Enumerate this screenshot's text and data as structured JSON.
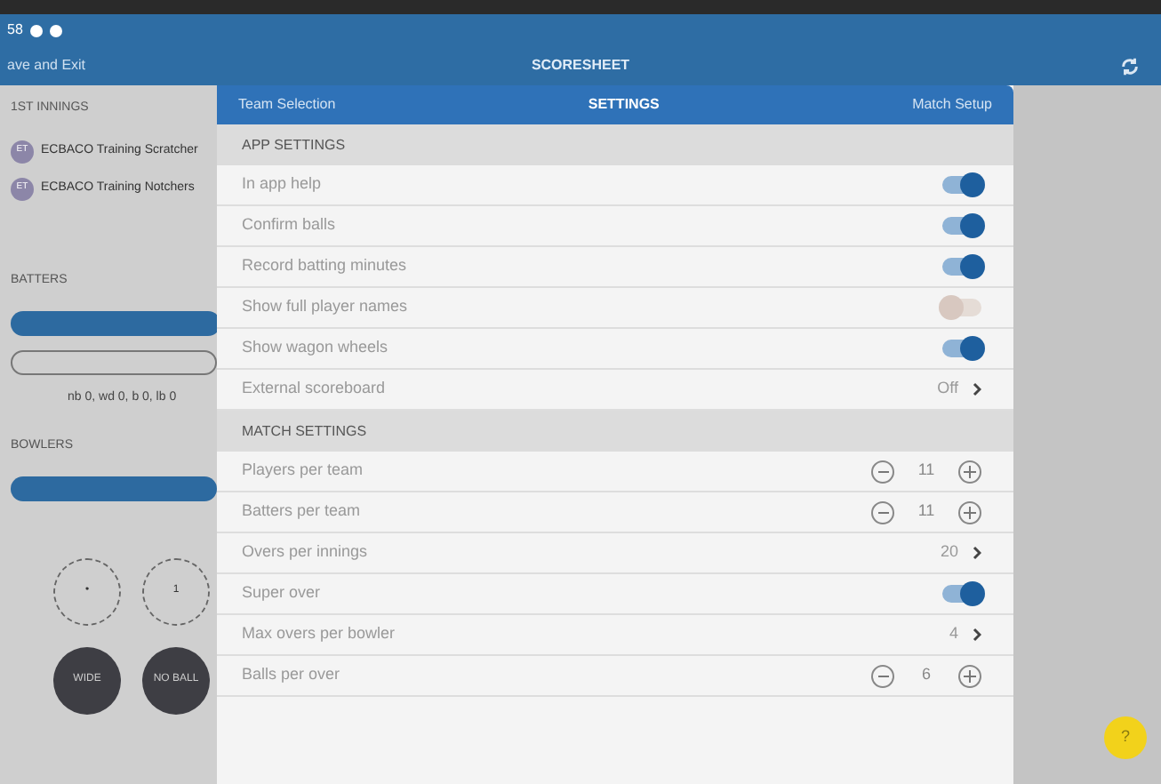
{
  "status_bar": {
    "time": "58"
  },
  "nav_bar": {
    "back": "ave and Exit",
    "title": "SCORESHEET"
  },
  "scoresheet": {
    "innings_title": "1ST INNINGS",
    "teams": [
      {
        "name": "ECBACO Training Scratcher",
        "initials": "ET"
      },
      {
        "name": "ECBACO Training Notchers",
        "initials": "ET"
      }
    ],
    "batters_title": "BATTERS",
    "extras": "nb 0, wd 0, b 0, lb 0",
    "bowlers_title": "BOWLERS",
    "ball_buttons": [
      {
        "label": "•",
        "kind": "outline"
      },
      {
        "label": "1",
        "kind": "outline"
      },
      {
        "label": "WIDE",
        "kind": "filled"
      },
      {
        "label": "NO BALL",
        "kind": "filled"
      }
    ]
  },
  "settings": {
    "tabs": [
      {
        "label": "Team Selection",
        "selected": false
      },
      {
        "label": "SETTINGS",
        "selected": true
      },
      {
        "label": "Match Setup",
        "selected": false
      }
    ],
    "sections": [
      {
        "title": "APP SETTINGS",
        "rows": [
          {
            "label": "In app help",
            "kind": "toggle",
            "on": true
          },
          {
            "label": "Confirm balls",
            "kind": "toggle",
            "on": true
          },
          {
            "label": "Record batting minutes",
            "kind": "toggle",
            "on": true
          },
          {
            "label": "Show full player names",
            "kind": "toggle",
            "on": false
          },
          {
            "label": "Show wagon wheels",
            "kind": "toggle",
            "on": true
          },
          {
            "label": "External scoreboard",
            "kind": "link",
            "value": "Off"
          }
        ]
      },
      {
        "title": "MATCH SETTINGS",
        "rows": [
          {
            "label": "Players per team",
            "kind": "stepper",
            "value": "11"
          },
          {
            "label": "Batters per team",
            "kind": "stepper",
            "value": "11"
          },
          {
            "label": "Overs per innings",
            "kind": "link",
            "value": "20"
          },
          {
            "label": "Super over",
            "kind": "toggle",
            "on": true
          },
          {
            "label": "Max overs per bowler",
            "kind": "link",
            "value": "4"
          },
          {
            "label": "Balls per over",
            "kind": "stepper",
            "value": "6"
          }
        ]
      }
    ]
  },
  "help_button": {
    "label": "?"
  }
}
